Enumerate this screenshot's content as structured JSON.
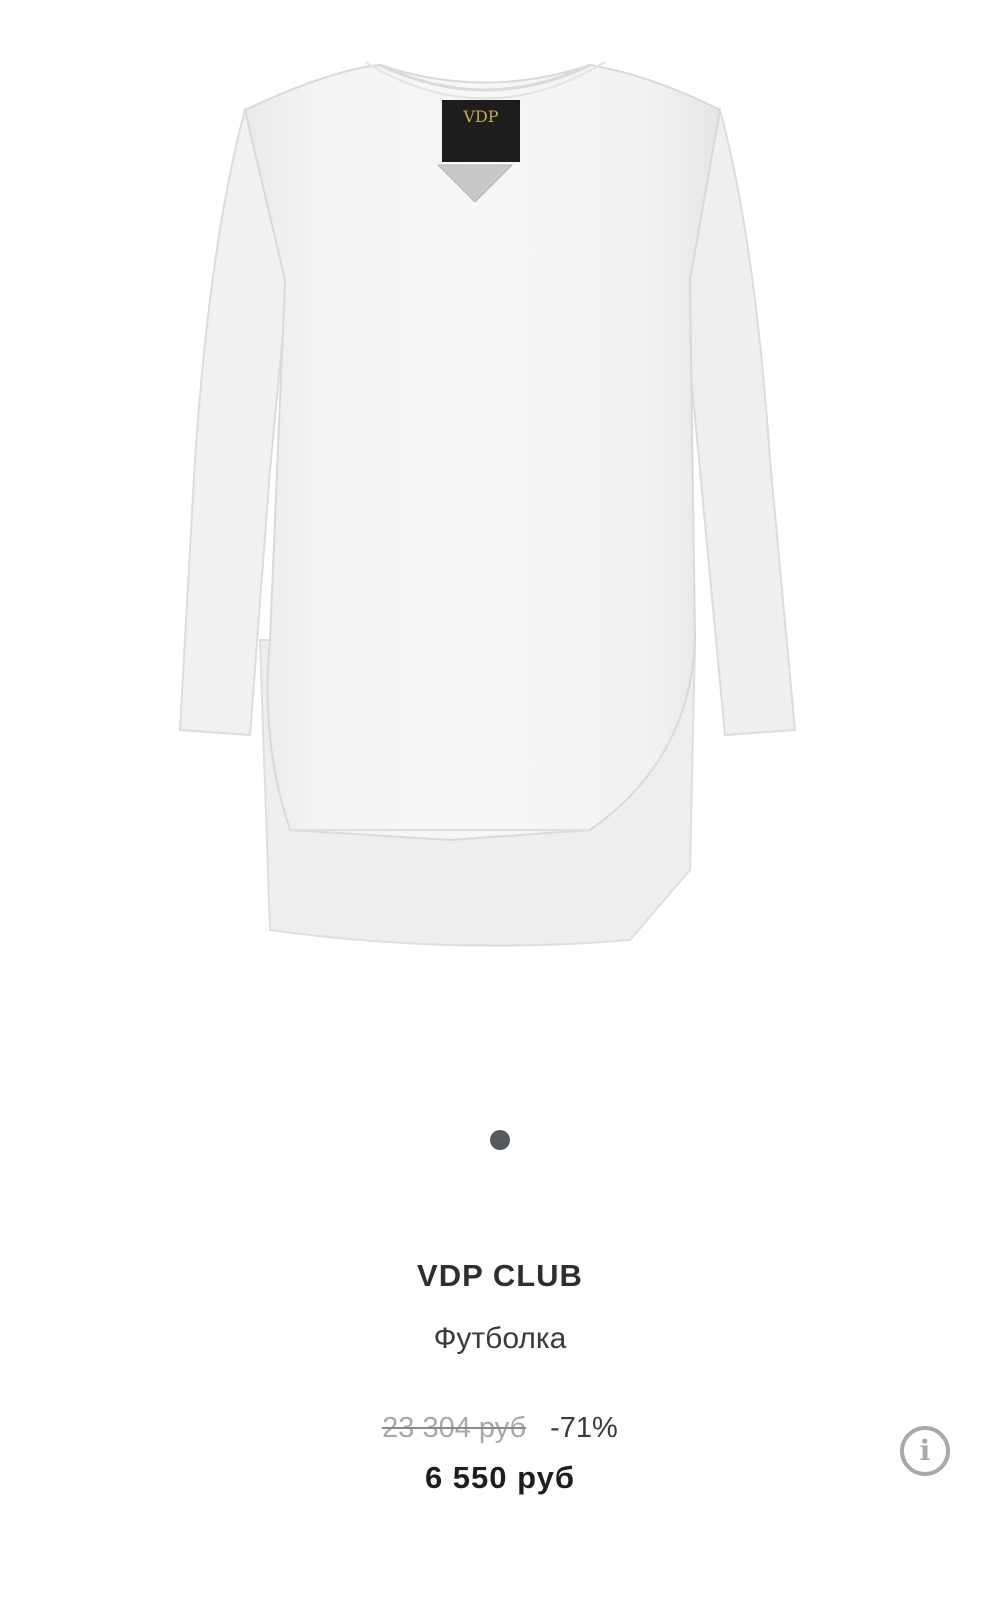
{
  "product": {
    "brand": "VDP CLUB",
    "name": "Футболка",
    "old_price": "23 304 руб",
    "discount": "-71%",
    "price": "6 550 руб",
    "label_text": "VDP"
  },
  "carousel": {
    "total_dots": 1,
    "active_index": 0
  },
  "info_button": {
    "glyph": "i",
    "icon": "info-icon"
  },
  "colors": {
    "dot": "#55595e",
    "icon": "#a9a9a9",
    "old_price": "#a8a8a8"
  }
}
